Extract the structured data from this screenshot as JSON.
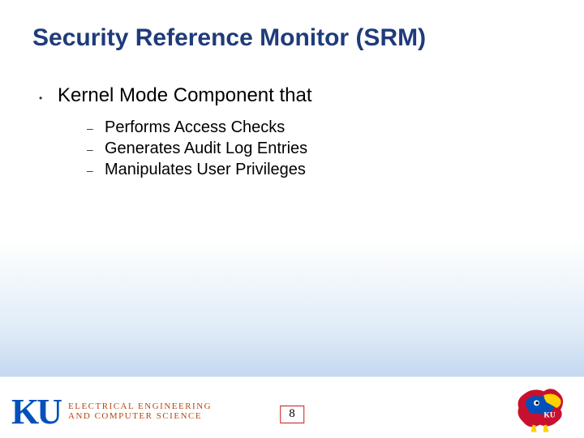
{
  "title": "Security Reference Monitor (SRM)",
  "bullet": {
    "text": "Kernel Mode Component that",
    "subs": [
      "Performs Access Checks",
      "Generates Audit Log Entries",
      "Manipulates User Privileges"
    ]
  },
  "footer": {
    "ku_mark": "KU",
    "dept_line1": "ELECTRICAL ENGINEERING",
    "dept_line2": "AND COMPUTER SCIENCE",
    "page_number": "8"
  }
}
